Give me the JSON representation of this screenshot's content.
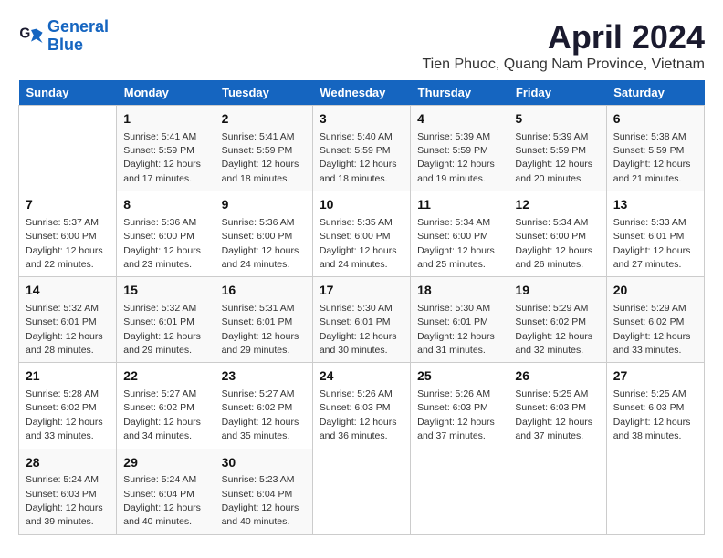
{
  "header": {
    "logo_line1": "General",
    "logo_line2": "Blue",
    "title": "April 2024",
    "subtitle": "Tien Phuoc, Quang Nam Province, Vietnam"
  },
  "calendar": {
    "days_of_week": [
      "Sunday",
      "Monday",
      "Tuesday",
      "Wednesday",
      "Thursday",
      "Friday",
      "Saturday"
    ],
    "weeks": [
      [
        {
          "day": null
        },
        {
          "day": 1,
          "sunrise": "5:41 AM",
          "sunset": "5:59 PM",
          "daylight": "12 hours and 17 minutes."
        },
        {
          "day": 2,
          "sunrise": "5:41 AM",
          "sunset": "5:59 PM",
          "daylight": "12 hours and 18 minutes."
        },
        {
          "day": 3,
          "sunrise": "5:40 AM",
          "sunset": "5:59 PM",
          "daylight": "12 hours and 18 minutes."
        },
        {
          "day": 4,
          "sunrise": "5:39 AM",
          "sunset": "5:59 PM",
          "daylight": "12 hours and 19 minutes."
        },
        {
          "day": 5,
          "sunrise": "5:39 AM",
          "sunset": "5:59 PM",
          "daylight": "12 hours and 20 minutes."
        },
        {
          "day": 6,
          "sunrise": "5:38 AM",
          "sunset": "5:59 PM",
          "daylight": "12 hours and 21 minutes."
        }
      ],
      [
        {
          "day": 7,
          "sunrise": "5:37 AM",
          "sunset": "6:00 PM",
          "daylight": "12 hours and 22 minutes."
        },
        {
          "day": 8,
          "sunrise": "5:36 AM",
          "sunset": "6:00 PM",
          "daylight": "12 hours and 23 minutes."
        },
        {
          "day": 9,
          "sunrise": "5:36 AM",
          "sunset": "6:00 PM",
          "daylight": "12 hours and 24 minutes."
        },
        {
          "day": 10,
          "sunrise": "5:35 AM",
          "sunset": "6:00 PM",
          "daylight": "12 hours and 24 minutes."
        },
        {
          "day": 11,
          "sunrise": "5:34 AM",
          "sunset": "6:00 PM",
          "daylight": "12 hours and 25 minutes."
        },
        {
          "day": 12,
          "sunrise": "5:34 AM",
          "sunset": "6:00 PM",
          "daylight": "12 hours and 26 minutes."
        },
        {
          "day": 13,
          "sunrise": "5:33 AM",
          "sunset": "6:01 PM",
          "daylight": "12 hours and 27 minutes."
        }
      ],
      [
        {
          "day": 14,
          "sunrise": "5:32 AM",
          "sunset": "6:01 PM",
          "daylight": "12 hours and 28 minutes."
        },
        {
          "day": 15,
          "sunrise": "5:32 AM",
          "sunset": "6:01 PM",
          "daylight": "12 hours and 29 minutes."
        },
        {
          "day": 16,
          "sunrise": "5:31 AM",
          "sunset": "6:01 PM",
          "daylight": "12 hours and 29 minutes."
        },
        {
          "day": 17,
          "sunrise": "5:30 AM",
          "sunset": "6:01 PM",
          "daylight": "12 hours and 30 minutes."
        },
        {
          "day": 18,
          "sunrise": "5:30 AM",
          "sunset": "6:01 PM",
          "daylight": "12 hours and 31 minutes."
        },
        {
          "day": 19,
          "sunrise": "5:29 AM",
          "sunset": "6:02 PM",
          "daylight": "12 hours and 32 minutes."
        },
        {
          "day": 20,
          "sunrise": "5:29 AM",
          "sunset": "6:02 PM",
          "daylight": "12 hours and 33 minutes."
        }
      ],
      [
        {
          "day": 21,
          "sunrise": "5:28 AM",
          "sunset": "6:02 PM",
          "daylight": "12 hours and 33 minutes."
        },
        {
          "day": 22,
          "sunrise": "5:27 AM",
          "sunset": "6:02 PM",
          "daylight": "12 hours and 34 minutes."
        },
        {
          "day": 23,
          "sunrise": "5:27 AM",
          "sunset": "6:02 PM",
          "daylight": "12 hours and 35 minutes."
        },
        {
          "day": 24,
          "sunrise": "5:26 AM",
          "sunset": "6:03 PM",
          "daylight": "12 hours and 36 minutes."
        },
        {
          "day": 25,
          "sunrise": "5:26 AM",
          "sunset": "6:03 PM",
          "daylight": "12 hours and 37 minutes."
        },
        {
          "day": 26,
          "sunrise": "5:25 AM",
          "sunset": "6:03 PM",
          "daylight": "12 hours and 37 minutes."
        },
        {
          "day": 27,
          "sunrise": "5:25 AM",
          "sunset": "6:03 PM",
          "daylight": "12 hours and 38 minutes."
        }
      ],
      [
        {
          "day": 28,
          "sunrise": "5:24 AM",
          "sunset": "6:03 PM",
          "daylight": "12 hours and 39 minutes."
        },
        {
          "day": 29,
          "sunrise": "5:24 AM",
          "sunset": "6:04 PM",
          "daylight": "12 hours and 40 minutes."
        },
        {
          "day": 30,
          "sunrise": "5:23 AM",
          "sunset": "6:04 PM",
          "daylight": "12 hours and 40 minutes."
        },
        {
          "day": null
        },
        {
          "day": null
        },
        {
          "day": null
        },
        {
          "day": null
        }
      ]
    ]
  }
}
